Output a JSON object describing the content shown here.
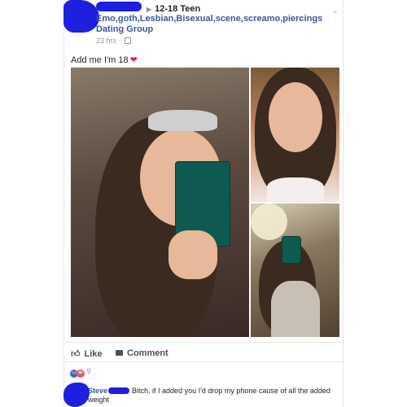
{
  "post": {
    "group_path": "12-18 Teen",
    "group_name": "Emo,goth,Lesbian,Bisexual,scene,screamo,piercings Dating Group",
    "timestamp": "23 hrs",
    "text": "Add me I'm 18",
    "reaction_count": "9"
  },
  "actions": {
    "like_label": "Like",
    "comment_label": "Comment"
  },
  "comment": {
    "author": "Steve",
    "text": "Bitch, if I added you I'd drop my phone cause of all the added weight"
  },
  "icons": {
    "heart": "heart-icon",
    "like": "thumbs-up-icon",
    "comment": "comment-icon",
    "globe": "globe-icon",
    "chevron": "chevron-down-icon"
  },
  "colors": {
    "link": "#365899",
    "redaction": "#1f1fe0",
    "like_blue": "#4267b2",
    "love_red": "#f25268"
  }
}
